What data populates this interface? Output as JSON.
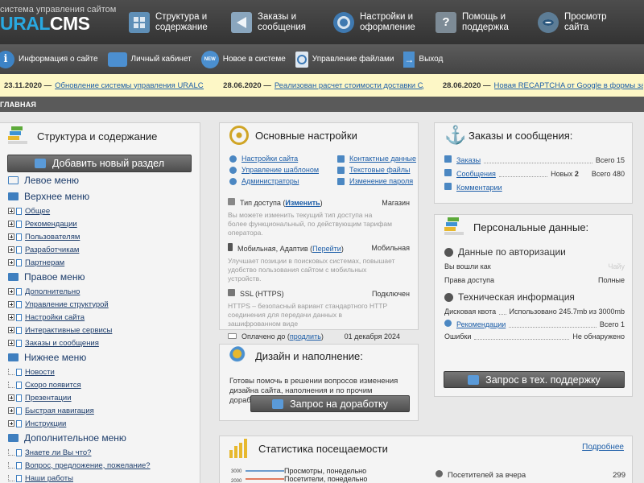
{
  "brand": {
    "subtitle": "система управления сайтом",
    "logo_a": "URAL",
    "logo_b": "CMS"
  },
  "topnav": [
    {
      "l1": "Структура и",
      "l2": "содержание",
      "icon": "grid-icon"
    },
    {
      "l1": "Заказы и",
      "l2": "сообщения",
      "icon": "megaphone-icon"
    },
    {
      "l1": "Настройки и",
      "l2": "оформление",
      "icon": "gear-icon"
    },
    {
      "l1": "Помощь и",
      "l2": "поддержка",
      "icon": "help-icon"
    },
    {
      "l1": "Просмотр",
      "l2": "сайта",
      "icon": "eye-icon"
    }
  ],
  "toolbar": [
    {
      "label": "Информация о сайте",
      "icon": "info-icon"
    },
    {
      "label": "Личный кабинет",
      "icon": "briefcase-icon"
    },
    {
      "label": "Новое в системе",
      "icon": "new-badge-icon"
    },
    {
      "label": "Управление файлами",
      "icon": "file-icon"
    },
    {
      "label": "Выход",
      "icon": "exit-icon"
    }
  ],
  "ticker": [
    {
      "date": "23.11.2020 —",
      "text": "Обновление системы управления URALCMS до вер"
    },
    {
      "date": "28.06.2020 —",
      "text": "Реализован расчет стоимости доставки СДЭК в зак"
    },
    {
      "date": "28.06.2020 —",
      "text": "Новая RECAPTCHA от Google в формы заказа и обр"
    }
  ],
  "breadcrumb": "ГЛАВНАЯ",
  "structure": {
    "title": "Структура и содержание",
    "add_button": "Добавить новый раздел",
    "sections": [
      {
        "title": "Левое меню",
        "items": []
      },
      {
        "title": "Верхнее меню",
        "items": [
          {
            "label": "Общее",
            "expandable": true
          },
          {
            "label": "Рекомендации",
            "expandable": true
          },
          {
            "label": "Пользователям",
            "expandable": true
          },
          {
            "label": "Разработчикам",
            "expandable": true
          },
          {
            "label": "Партнерам",
            "expandable": true
          }
        ]
      },
      {
        "title": "Правое меню",
        "items": [
          {
            "label": "Дополнительно",
            "expandable": true
          },
          {
            "label": "Управление структурой",
            "expandable": true
          },
          {
            "label": "Настройки сайта",
            "expandable": true
          },
          {
            "label": "Интерактивные сервисы",
            "expandable": true
          },
          {
            "label": "Заказы и сообщения",
            "expandable": true
          }
        ]
      },
      {
        "title": "Нижнее меню",
        "items": [
          {
            "label": "Новости",
            "expandable": false
          },
          {
            "label": "Скоро появится",
            "expandable": false
          },
          {
            "label": "Презентации",
            "expandable": true
          },
          {
            "label": "Быстрая навигация",
            "expandable": true
          },
          {
            "label": "Инструкции",
            "expandable": true
          }
        ]
      },
      {
        "title": "Дополнительное меню",
        "items": [
          {
            "label": "Знаете ли Вы что?",
            "expandable": false
          },
          {
            "label": "Вопрос, предложение, пожелание?",
            "expandable": false
          },
          {
            "label": "Наши работы",
            "expandable": false
          }
        ]
      }
    ]
  },
  "settings": {
    "title": "Основные настройки",
    "links_left": [
      "Настройки сайта",
      "Управление шаблоном",
      "Администраторы"
    ],
    "links_right": [
      "Контактные данные",
      "Текстовые файлы",
      "Изменение пароля"
    ],
    "access": {
      "label": "Тип доступа (",
      "action": "Изменить",
      "close": ")",
      "value": "Магазин"
    },
    "access_note": "Вы можете изменить текущий тип доступа на более функциональный, по действующим тарифам оператора.",
    "mobile": {
      "label": "Мобильная, Адаптив (",
      "action": "Перейти",
      "close": ")",
      "value": "Мобильная"
    },
    "mobile_note": "Улучшает позиции в поисковых системах, повышает удобство пользования сайтом с мобильных устройств.",
    "ssl": {
      "label": "SSL (HTTPS)",
      "value": "Подключен"
    },
    "ssl_note": "HTTPS – безопасный вариант стандартного HTTP соединения для передачи данных в зашифрованном виде",
    "paid": {
      "label": "Оплачено до (",
      "action": "продлить",
      "close": ")",
      "value": "01 декабря 2024"
    }
  },
  "orders": {
    "title": "Заказы и сообщения:",
    "rows": [
      {
        "label": "Заказы",
        "mid": "",
        "mid_count": "",
        "total": "Всего 15"
      },
      {
        "label": "Сообщения",
        "mid": "Новых",
        "mid_count": "2",
        "total": "Всего 480"
      },
      {
        "label": "Комментарии",
        "mid": "",
        "mid_count": "",
        "total": ""
      }
    ]
  },
  "personal": {
    "title": "Персональные данные:",
    "auth_title": "Данные по авторизации",
    "login_label": "Вы вошли как",
    "login_value": "Чайу",
    "rights_label": "Права доступа",
    "rights_value": "Полные",
    "tech_title": "Техническая информация",
    "quota_label": "Дисковая квота",
    "quota_value": "Использовано 245.7mb из 3000mb",
    "rec_label": "Рекомендации",
    "rec_value": "Всего 1",
    "err_label": "Ошибки",
    "err_value": "Не обнаружено",
    "support_button": "Запрос в тех. поддержку"
  },
  "design": {
    "title": "Дизайн и наполнение:",
    "text": "Готовы помочь в решении вопросов изменения дизайна сайта, наполнения и по прочим доработкам.",
    "button": "Запрос на доработку"
  },
  "stats": {
    "title": "Статистика посещаемости",
    "more_link": "Подробнее",
    "legend": [
      "Просмотры, понедельно",
      "Посетители, понедельно"
    ],
    "y_ticks": [
      "3000",
      "2000"
    ],
    "visitors_label": "Посетителей за вчера",
    "visitors_value": "299"
  },
  "colors": {
    "accent": "#1d5ea8",
    "ticker_bg": "#fdf7c6",
    "header_bg": "#3a3a3a",
    "logo_blue": "#29a8e0"
  }
}
